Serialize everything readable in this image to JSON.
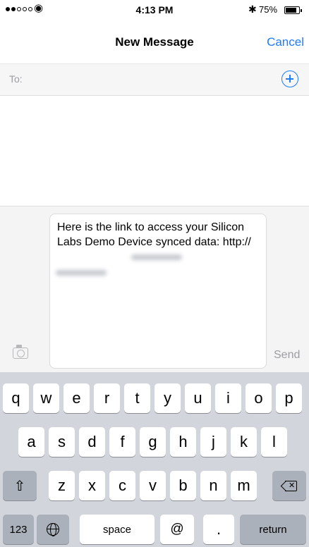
{
  "status_bar": {
    "time": "4:13 PM",
    "battery_percent": "75%",
    "battery_level": 0.75,
    "signal_bars_filled": 2,
    "signal_bars_total": 5,
    "wifi_icon": "wifi-icon",
    "bluetooth_icon": "bluetooth-icon"
  },
  "nav": {
    "title": "New Message",
    "cancel_label": "Cancel"
  },
  "to_field": {
    "label": "To:",
    "add_icon": "add-contact-icon"
  },
  "compose": {
    "message_text": "Here is the link to access your Silicon Labs Demo Device synced data: http://",
    "send_label": "Send",
    "camera_icon": "camera-icon"
  },
  "keyboard": {
    "row1": [
      "q",
      "w",
      "e",
      "r",
      "t",
      "y",
      "u",
      "i",
      "o",
      "p"
    ],
    "row2": [
      "a",
      "s",
      "d",
      "f",
      "g",
      "h",
      "j",
      "k",
      "l"
    ],
    "row3": [
      "z",
      "x",
      "c",
      "v",
      "b",
      "n",
      "m"
    ],
    "numbers_label": "123",
    "space_label": "space",
    "at_label": "@",
    "period_label": ".",
    "return_label": "return"
  },
  "colors": {
    "accent": "#1a7cff",
    "keyboard_bg": "#d2d5db",
    "key_bg": "#ffffff",
    "key_dark_bg": "#abb1ba"
  }
}
